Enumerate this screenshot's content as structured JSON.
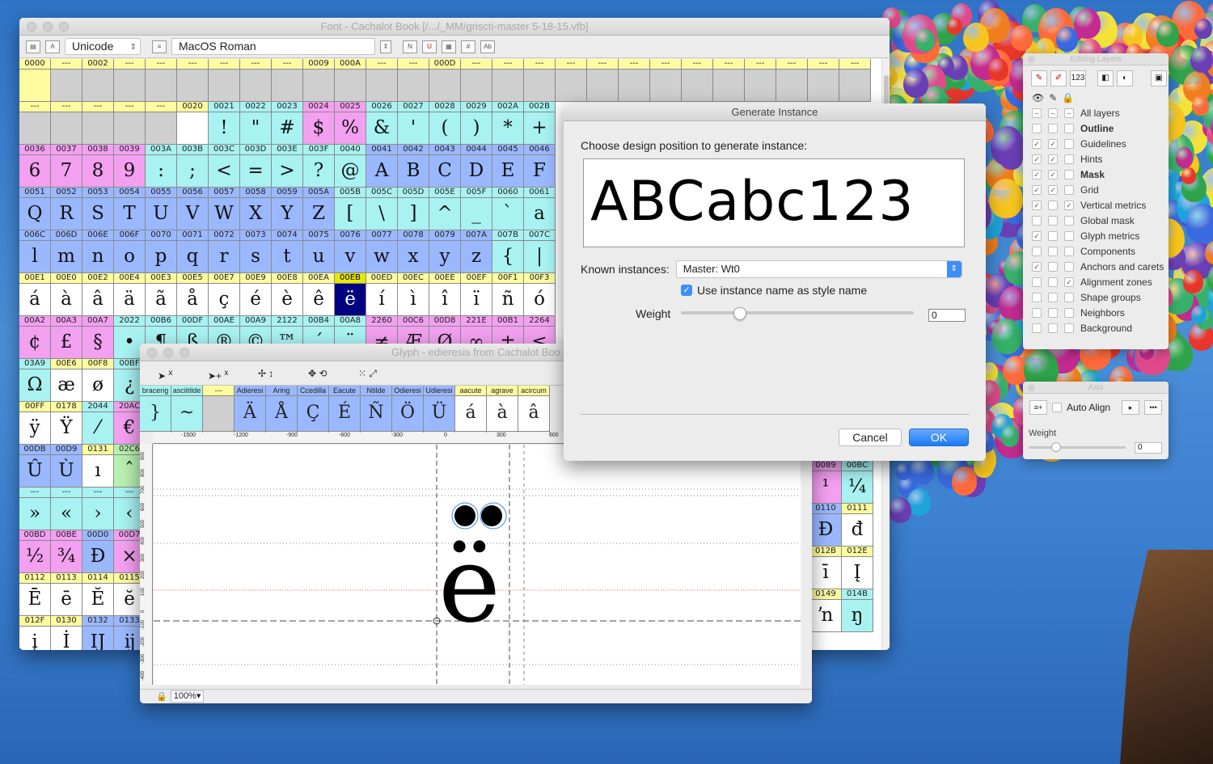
{
  "font_window": {
    "title": "Font - Cachalot Book [/.../_MM/griscti-master 5-18-15.vfb]",
    "encoding_mode": "Unicode",
    "codepage": "MacOS Roman"
  },
  "font_grid": [
    {
      "h": [
        "0000",
        "---",
        "0002",
        "---",
        "---",
        "---",
        "---",
        "---",
        "---",
        "0009",
        "000A",
        "---",
        "---",
        "000D",
        "---",
        "---",
        "---",
        "---",
        "---",
        "---",
        "---",
        "---",
        "---",
        "---",
        "---",
        "---",
        "---"
      ],
      "g": [
        "",
        "",
        "",
        "",
        "",
        "",
        "",
        "",
        "",
        "",
        "",
        "",
        "",
        "",
        "",
        "",
        "",
        "",
        "",
        "",
        "",
        "",
        "",
        "",
        "",
        "",
        ""
      ],
      "c": [
        "y",
        "g",
        "g",
        "g",
        "g",
        "g",
        "g",
        "g",
        "g",
        "g",
        "g",
        "g",
        "g",
        "g",
        "g",
        "g",
        "g",
        "g",
        "g",
        "g",
        "g",
        "g",
        "g",
        "g",
        "g",
        "g",
        "g"
      ]
    },
    {
      "h": [
        "---",
        "---",
        "---",
        "---",
        "---",
        "0020",
        "0021",
        "0022",
        "0023",
        "0024",
        "0025",
        "0026",
        "0027",
        "0028",
        "0029",
        "002A",
        "002B"
      ],
      "g": [
        "",
        "",
        "",
        "",
        "",
        "",
        " ! ",
        "\"",
        "#",
        "$",
        "%",
        "&",
        "'",
        "(",
        ")",
        "*",
        "+"
      ],
      "c": [
        "g",
        "g",
        "g",
        "g",
        "g",
        "w",
        "c",
        "c",
        "c",
        "m",
        "m",
        "c",
        "c",
        "c",
        "c",
        "c",
        "c"
      ]
    },
    {
      "h": [
        "0036",
        "0037",
        "0038",
        "0039",
        "003A",
        "003B",
        "003C",
        "003D",
        "003E",
        "003F",
        "0040",
        "0041",
        "0042",
        "0043",
        "0044",
        "0045",
        "0046"
      ],
      "g": [
        "6",
        "7",
        "8",
        "9",
        ":",
        ";",
        "<",
        "=",
        ">",
        "?",
        "@",
        "A",
        "B",
        "C",
        "D",
        "E",
        "F"
      ],
      "c": [
        "m",
        "m",
        "m",
        "m",
        "c",
        "c",
        "c",
        "c",
        "c",
        "c",
        "c",
        "b",
        "b",
        "b",
        "b",
        "b",
        "b"
      ]
    },
    {
      "h": [
        "0051",
        "0052",
        "0053",
        "0054",
        "0055",
        "0056",
        "0057",
        "0058",
        "0059",
        "005A",
        "005B",
        "005C",
        "005D",
        "005E",
        "005F",
        "0060",
        "0061"
      ],
      "g": [
        "Q",
        "R",
        "S",
        "T",
        "U",
        "V",
        "W",
        "X",
        "Y",
        "Z",
        "[",
        "\\",
        "]",
        "^",
        "_",
        "`",
        "a"
      ],
      "c": [
        "b",
        "b",
        "b",
        "b",
        "b",
        "b",
        "b",
        "b",
        "b",
        "b",
        "c",
        "c",
        "c",
        "c",
        "c",
        "c",
        "c"
      ]
    },
    {
      "h": [
        "006C",
        "006D",
        "006E",
        "006F",
        "0070",
        "0071",
        "0072",
        "0073",
        "0074",
        "0075",
        "0076",
        "0077",
        "0078",
        "0079",
        "007A",
        "007B",
        "007C"
      ],
      "g": [
        "l",
        "m",
        "n",
        "o",
        "p",
        "q",
        "r",
        "s",
        "t",
        "u",
        "v",
        "w",
        "x",
        "y",
        "z",
        "{",
        "|"
      ],
      "c": [
        "b",
        "b",
        "b",
        "b",
        "b",
        "b",
        "b",
        "b",
        "b",
        "b",
        "b",
        "b",
        "b",
        "b",
        "b",
        "c",
        "c"
      ]
    },
    {
      "h": [
        "00E1",
        "00E0",
        "00E2",
        "00E4",
        "00E3",
        "00E5",
        "00E7",
        "00E9",
        "00E8",
        "00EA",
        "00EB",
        "00ED",
        "00EC",
        "00EE",
        "00EF",
        "00F1",
        "00F3"
      ],
      "g": [
        "á",
        "à",
        "â",
        "ä",
        "ã",
        "å",
        "ç",
        "é",
        "è",
        "ê",
        "ë",
        "í",
        "ì",
        "î",
        "ï",
        "ñ",
        "ó"
      ],
      "c": [
        "w",
        "w",
        "w",
        "w",
        "w",
        "w",
        "w",
        "w",
        "w",
        "w",
        "k",
        "w",
        "w",
        "w",
        "w",
        "w",
        "w"
      ]
    },
    {
      "h": [
        "00A2",
        "00A3",
        "00A7",
        "2022",
        "00B6",
        "00DF",
        "00AE",
        "00A9",
        "2122",
        "00B4",
        "00A8",
        "2260",
        "00C6",
        "00D8",
        "221E",
        "00B1",
        "2264"
      ],
      "g": [
        "¢",
        "£",
        "§",
        "•",
        "¶",
        "ß",
        "®",
        "©",
        "™",
        "´",
        "¨",
        "≠",
        "Æ",
        "Ø",
        "∞",
        "±",
        "≤"
      ],
      "c": [
        "m",
        "m",
        "m",
        "c",
        "c",
        "c",
        "c",
        "c",
        "c",
        "c",
        "c",
        "m",
        "m",
        "m",
        "m",
        "m",
        "m"
      ]
    },
    {
      "h": [
        "03A9",
        "00E6",
        "00F8",
        "00BF"
      ],
      "g": [
        "Ω",
        "æ",
        "ø",
        "¿"
      ],
      "c": [
        "c",
        "w",
        "w",
        "c"
      ]
    },
    {
      "h": [
        "00FF",
        "0178",
        "2044",
        "20AC"
      ],
      "g": [
        "ÿ",
        "Ÿ",
        "⁄",
        "€"
      ],
      "c": [
        "w",
        "w",
        "c",
        "m"
      ]
    },
    {
      "h": [
        "00DB",
        "00D9",
        "0131",
        "02C6"
      ],
      "g": [
        "Û",
        "Ù",
        "ı",
        "ˆ"
      ],
      "c": [
        "b",
        "b",
        "w",
        "gr"
      ]
    },
    {
      "h": [
        "---",
        "---",
        "---",
        "---"
      ],
      "g": [
        "»",
        "«",
        "›",
        "‹"
      ],
      "c": [
        "c",
        "c",
        "c",
        "c"
      ]
    },
    {
      "h": [
        "00BD",
        "00BE",
        "00D0",
        "00D7"
      ],
      "g": [
        "½",
        "¾",
        "Ð",
        "×"
      ],
      "c": [
        "m",
        "m",
        "b",
        "m"
      ]
    },
    {
      "h": [
        "0112",
        "0113",
        "0114",
        "0115"
      ],
      "g": [
        "Ē",
        "ē",
        "Ĕ",
        "ĕ"
      ],
      "c": [
        "w",
        "w",
        "w",
        "w"
      ]
    },
    {
      "h": [
        "012F",
        "0130",
        "0132",
        "0133"
      ],
      "g": [
        "į",
        "İ",
        "Ĳ",
        "ĳ"
      ],
      "c": [
        "w",
        "w",
        "b",
        "b"
      ]
    }
  ],
  "font_grid_right": [
    {
      "h": [
        "0089",
        "00BC"
      ],
      "g": [
        "¹",
        "¼"
      ],
      "c": [
        "m",
        "c"
      ]
    },
    {
      "h": [
        "0110",
        "0111"
      ],
      "g": [
        "Đ",
        "đ"
      ],
      "c": [
        "b",
        "w"
      ]
    },
    {
      "h": [
        "012B",
        "012E"
      ],
      "g": [
        "ī",
        "Į"
      ],
      "c": [
        "w",
        "w"
      ]
    },
    {
      "h": [
        "0149",
        "014B"
      ],
      "g": [
        "ŉ",
        "ŋ"
      ],
      "c": [
        "w",
        "c"
      ]
    }
  ],
  "glyph_window": {
    "title": "Glyph - edieresis from Cachalot Boo",
    "zoom": "100%▾",
    "strip": [
      {
        "n": "bracerig",
        "g": "}",
        "c": "c"
      },
      {
        "n": "asciitilde",
        "g": "~",
        "c": "c"
      },
      {
        "n": "---",
        "g": "",
        "c": "g"
      },
      {
        "n": "Adieresi",
        "g": "Ä",
        "c": "b"
      },
      {
        "n": "Aring",
        "g": "Å",
        "c": "b"
      },
      {
        "n": "Ccedilla",
        "g": "Ç",
        "c": "b"
      },
      {
        "n": "Eacute",
        "g": "É",
        "c": "b"
      },
      {
        "n": "Ntilde",
        "g": "Ñ",
        "c": "b"
      },
      {
        "n": "Odieresi",
        "g": "Ö",
        "c": "b"
      },
      {
        "n": "Udieresi",
        "g": "Ü",
        "c": "b"
      },
      {
        "n": "aacute",
        "g": "á",
        "c": "w"
      },
      {
        "n": "agrave",
        "g": "à",
        "c": "w"
      },
      {
        "n": "acircum",
        "g": "â",
        "c": "w"
      }
    ],
    "hruler": [
      "-1500",
      "-1200",
      "-900",
      "-600",
      "-300",
      "0",
      "300",
      "600"
    ],
    "vruler": [
      "900",
      "800",
      "700",
      "600",
      "500",
      "400",
      "300",
      "200",
      "100",
      "0",
      "-100",
      "-200",
      "-300",
      "-400"
    ],
    "glyph": "ë"
  },
  "generate_dialog": {
    "title": "Generate Instance",
    "prompt": "Choose design position to generate instance:",
    "preview_text": "ABCabc123",
    "known_label": "Known instances:",
    "known_value": "Master: Wt0",
    "use_name_label": "Use instance name as style name",
    "weight_label": "Weight",
    "weight_value": "0",
    "cancel": "Cancel",
    "ok": "OK"
  },
  "layers_panel": {
    "title": "Editing Layers",
    "all_layers": "All layers",
    "items": [
      {
        "label": "Outline",
        "bold": true,
        "v": [
          "",
          "",
          ""
        ]
      },
      {
        "label": "Guidelines",
        "v": [
          "✓",
          "✓",
          ""
        ]
      },
      {
        "label": "Hints",
        "v": [
          "✓",
          "✓",
          ""
        ]
      },
      {
        "label": "Mask",
        "bold": true,
        "v": [
          "✓",
          "✓",
          ""
        ]
      },
      {
        "label": "Grid",
        "v": [
          "✓",
          "✓",
          ""
        ]
      },
      {
        "label": "Vertical metrics",
        "v": [
          "✓",
          "",
          "✓"
        ]
      },
      {
        "label": "Global mask",
        "v": [
          "",
          "",
          ""
        ]
      },
      {
        "label": "Glyph metrics",
        "v": [
          "✓",
          "",
          ""
        ]
      },
      {
        "label": "Components",
        "v": [
          "",
          "",
          ""
        ]
      },
      {
        "label": "Anchors and carets",
        "v": [
          "✓",
          "",
          ""
        ]
      },
      {
        "label": "Alignment zones",
        "v": [
          "",
          "",
          "✓"
        ]
      },
      {
        "label": "Shape groups",
        "v": [
          "",
          "",
          ""
        ]
      },
      {
        "label": "Neighbors",
        "v": [
          "",
          "",
          ""
        ]
      },
      {
        "label": "Background",
        "v": [
          "",
          "",
          ""
        ]
      }
    ]
  },
  "axis_panel": {
    "title": "Axis",
    "auto_align": "Auto Align",
    "weight_label": "Weight",
    "weight_value": "0"
  }
}
